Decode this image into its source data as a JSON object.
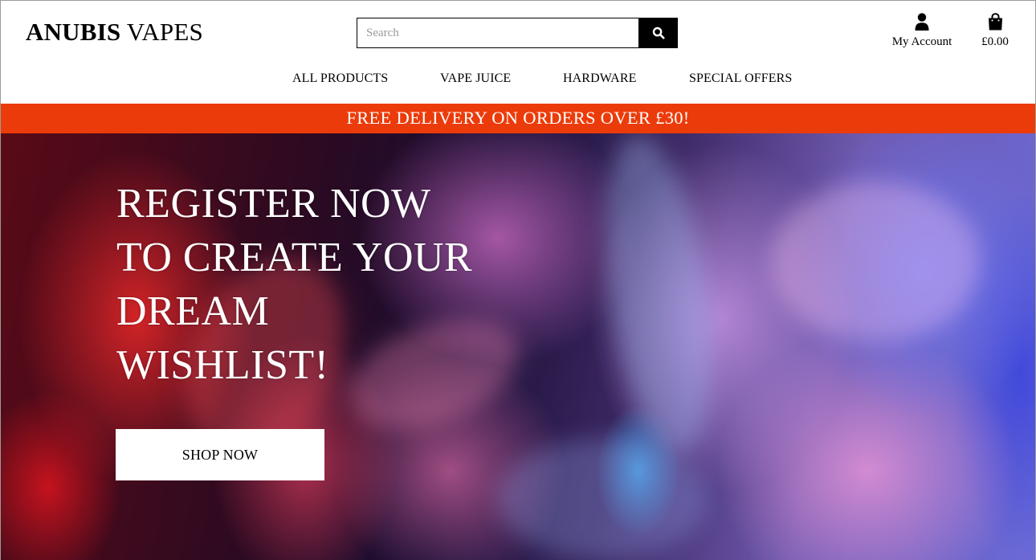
{
  "header": {
    "brand_bold": "ANUBIS",
    "brand_light": " VAPES",
    "search": {
      "placeholder": "Search",
      "value": ""
    },
    "account_label": "My Account",
    "bag_total": "£0.00",
    "icons": {
      "search": "search-icon",
      "account": "user-icon",
      "bag": "shopping-bag-icon"
    }
  },
  "nav": {
    "items": [
      {
        "label": "ALL PRODUCTS"
      },
      {
        "label": "VAPE JUICE"
      },
      {
        "label": "HARDWARE"
      },
      {
        "label": "SPECIAL OFFERS"
      }
    ]
  },
  "promo": {
    "text": "FREE DELIVERY ON ORDERS OVER £30!"
  },
  "hero": {
    "lines": [
      "REGISTER NOW",
      "TO CREATE YOUR",
      "DREAM",
      "WISHLIST!"
    ],
    "cta_label": "SHOP NOW"
  },
  "colors": {
    "promo_bg": "#ec3b0a",
    "text": "#000000",
    "on_hero": "#ffffff"
  }
}
